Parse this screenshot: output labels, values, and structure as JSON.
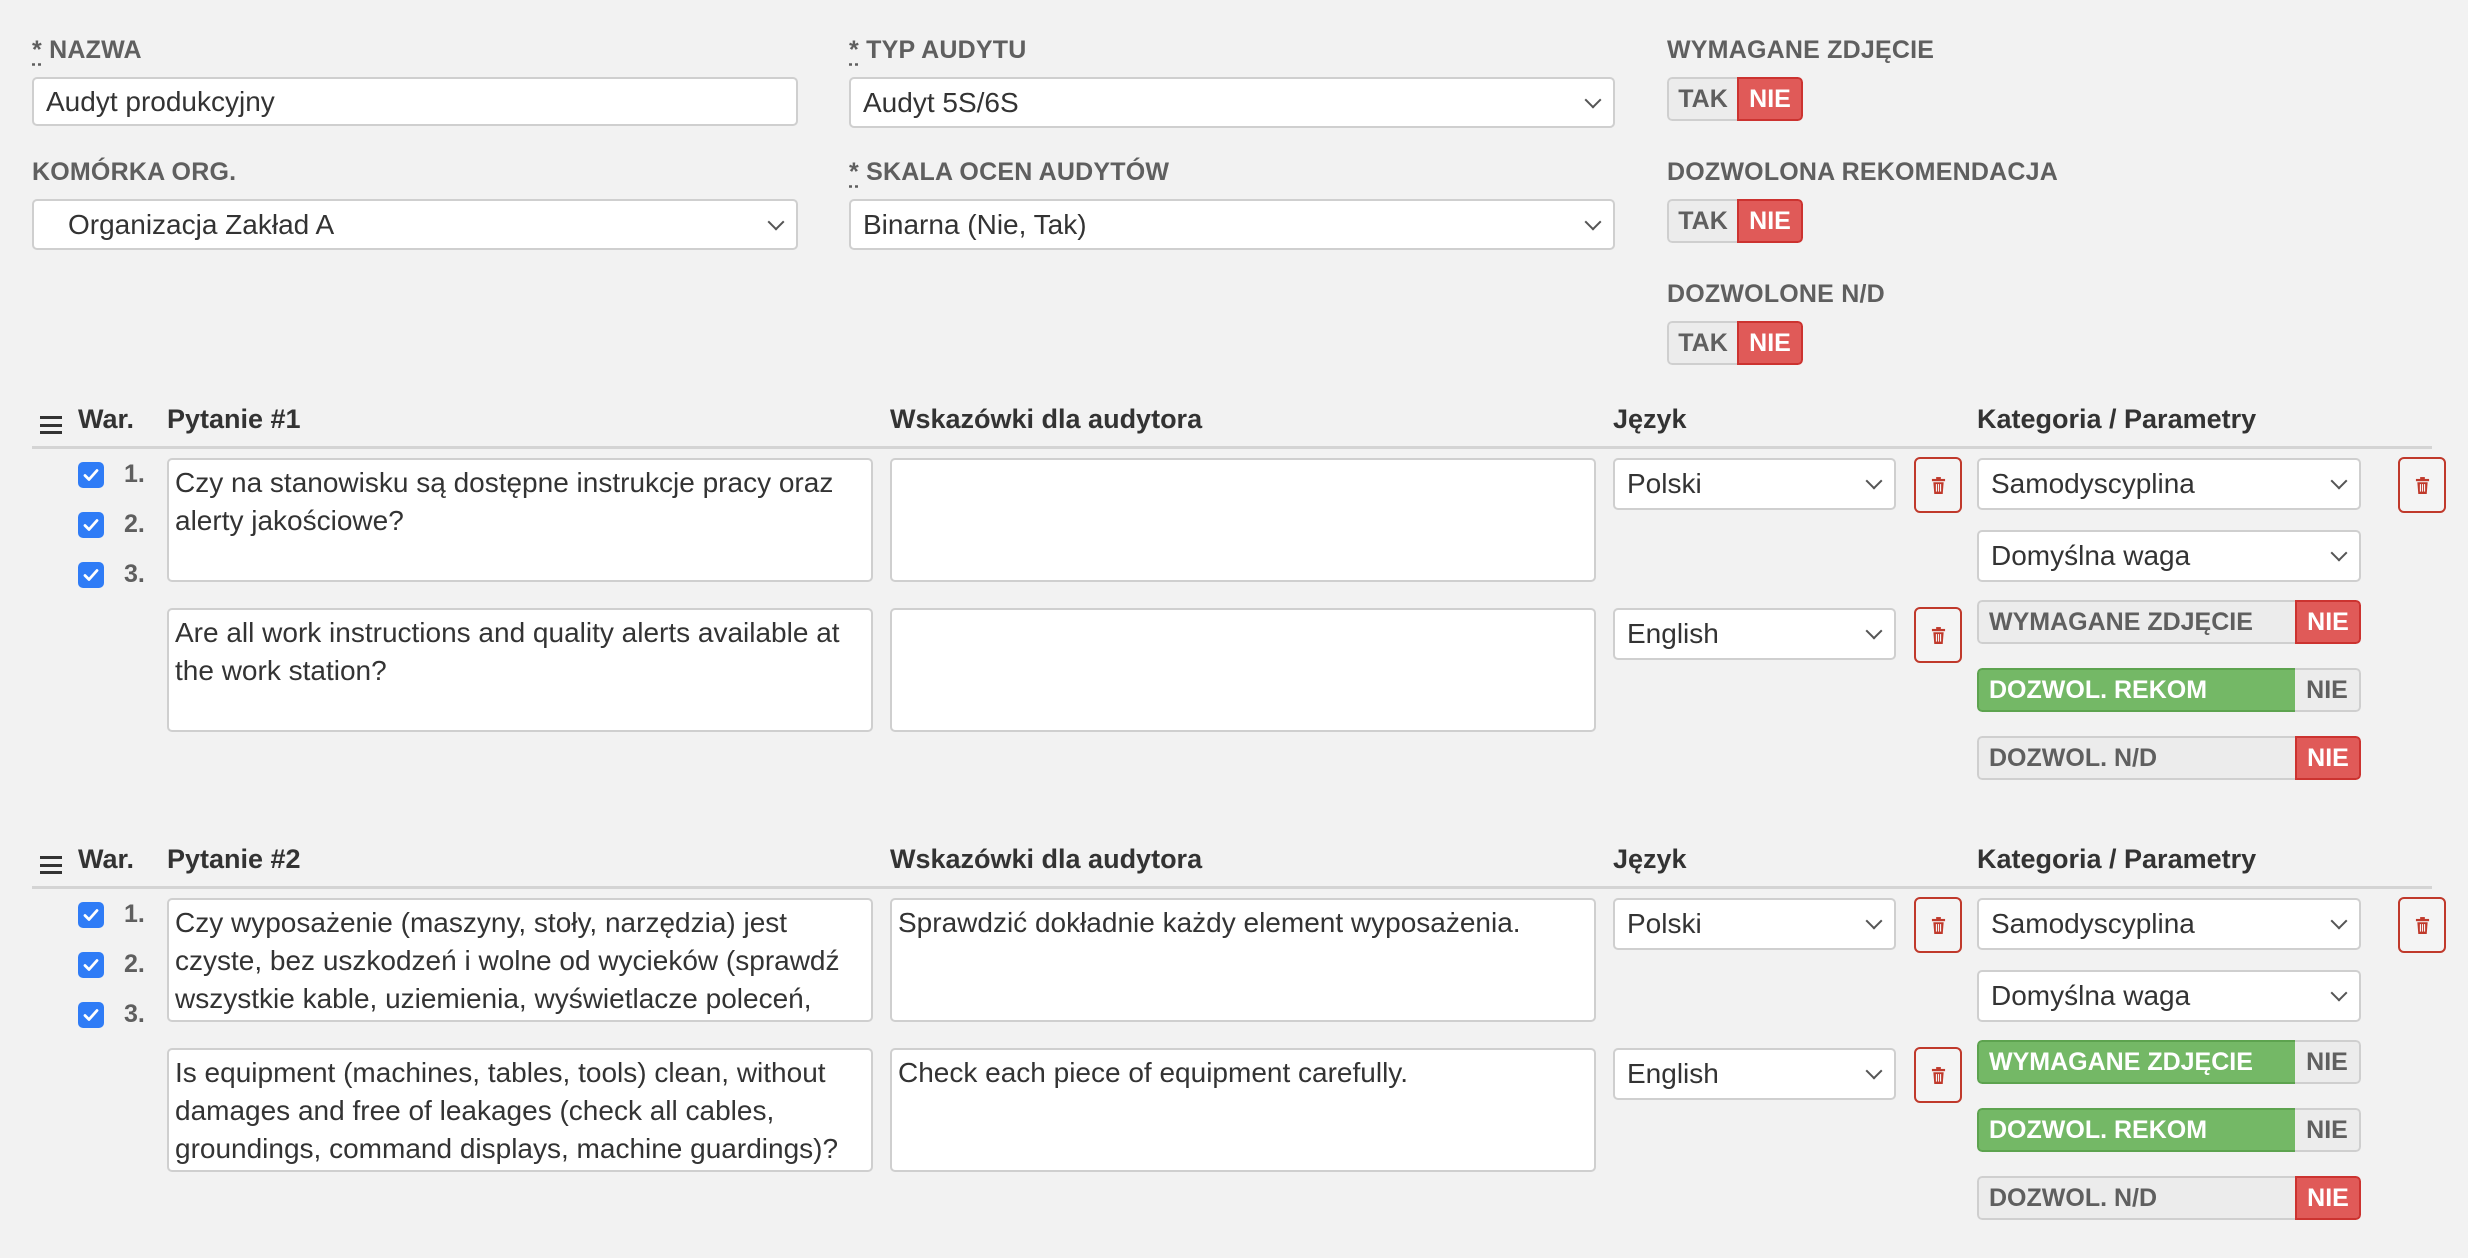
{
  "form": {
    "name": {
      "label": "NAZWA",
      "required_mark": "*",
      "value": "Audyt produkcyjny"
    },
    "audit_type": {
      "label": "TYP AUDYTU",
      "required_mark": "*",
      "value": "Audyt 5S/6S"
    },
    "org_unit": {
      "label": "KOMÓRKA ORG.",
      "value": "Organizacja Zakład A"
    },
    "rating_scale": {
      "label": "SKALA OCEN AUDYTÓW",
      "required_mark": "*",
      "value": "Binarna (Nie, Tak)"
    },
    "toggles": [
      {
        "label": "WYMAGANE ZDJĘCIE",
        "yes": "TAK",
        "no": "NIE",
        "value": "NIE"
      },
      {
        "label": "DOZWOLONA REKOMENDACJA",
        "yes": "TAK",
        "no": "NIE",
        "value": "NIE"
      },
      {
        "label": "DOZWOLONE N/D",
        "yes": "TAK",
        "no": "NIE",
        "value": "NIE"
      }
    ]
  },
  "columns": {
    "variants": "War.",
    "guidance": "Wskazówki dla audytora",
    "language": "Język",
    "category": "Kategoria / Parametry"
  },
  "colors": {
    "accent": "#2f7cf6",
    "danger": "#e05a58",
    "success": "#74b866"
  },
  "questions": [
    {
      "title": "Pytanie #1",
      "variants": [
        {
          "label": "1.",
          "checked": true
        },
        {
          "label": "2.",
          "checked": true
        },
        {
          "label": "3.",
          "checked": true
        }
      ],
      "translations": [
        {
          "text": "Czy na stanowisku są dostępne instrukcje pracy oraz alerty jakościowe?",
          "guidance": "",
          "language": "Polski"
        },
        {
          "text": "Are all work instructions and quality alerts available at the work station?",
          "guidance": "",
          "language": "English"
        }
      ],
      "category": "Samodyscyplina",
      "weight": "Domyślna waga",
      "params": [
        {
          "label": "WYMAGANE ZDJĘCIE",
          "value": "NIE",
          "active": false
        },
        {
          "label": "DOZWOL. REKOM",
          "value": "NIE",
          "active": true
        },
        {
          "label": "DOZWOL. N/D",
          "value": "NIE",
          "active": false
        }
      ]
    },
    {
      "title": "Pytanie #2",
      "variants": [
        {
          "label": "1.",
          "checked": true
        },
        {
          "label": "2.",
          "checked": true
        },
        {
          "label": "3.",
          "checked": true
        }
      ],
      "translations": [
        {
          "text": "Czy wyposażenie (maszyny, stoły, narzędzia) jest czyste, bez uszkodzeń i wolne od wycieków (sprawdź wszystkie kable, uziemienia, wyświetlacze poleceń,",
          "guidance": "Sprawdzić dokładnie każdy element wyposażenia.",
          "language": "Polski"
        },
        {
          "text": "Is equipment (machines, tables, tools) clean, without damages and free of leakages (check all cables, groundings, command displays, machine guardings)?",
          "guidance": "Check each piece of equipment carefully.",
          "language": "English"
        }
      ],
      "category": "Samodyscyplina",
      "weight": "Domyślna waga",
      "params": [
        {
          "label": "WYMAGANE ZDJĘCIE",
          "value": "NIE",
          "active": true
        },
        {
          "label": "DOZWOL. REKOM",
          "value": "NIE",
          "active": true
        },
        {
          "label": "DOZWOL. N/D",
          "value": "NIE",
          "active": false
        }
      ]
    }
  ]
}
